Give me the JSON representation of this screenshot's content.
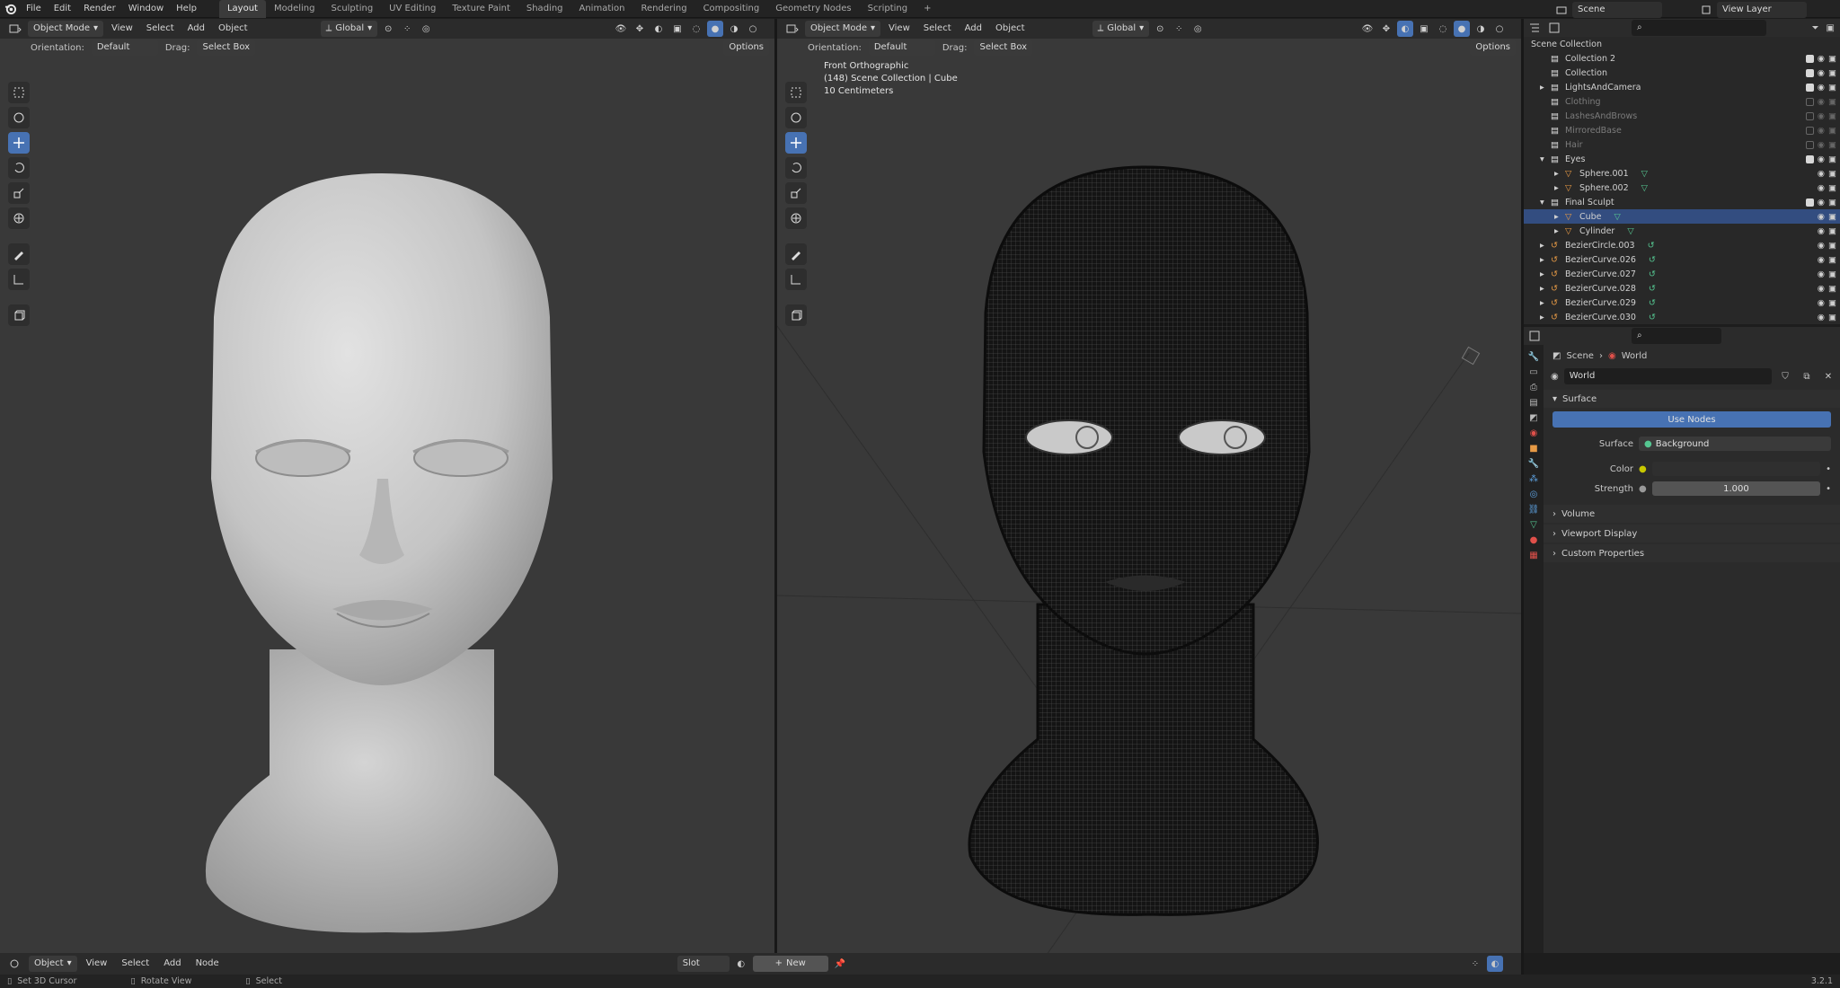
{
  "topbar": {
    "menu": [
      "File",
      "Edit",
      "Render",
      "Window",
      "Help"
    ],
    "workspaces": [
      "Layout",
      "Modeling",
      "Sculpting",
      "UV Editing",
      "Texture Paint",
      "Shading",
      "Animation",
      "Rendering",
      "Compositing",
      "Geometry Nodes",
      "Scripting"
    ],
    "active_workspace": "Layout",
    "add_tab": "+",
    "scene_label": "Scene",
    "view_layer_label": "View Layer"
  },
  "left_viewport": {
    "mode": "Object Mode",
    "menus": [
      "View",
      "Select",
      "Add",
      "Object"
    ],
    "transform": "Global",
    "orientation_label": "Orientation:",
    "orientation_value": "Default",
    "drag_label": "Drag:",
    "drag_value": "Select Box",
    "options": "Options"
  },
  "right_viewport": {
    "mode": "Object Mode",
    "menus": [
      "View",
      "Select",
      "Add",
      "Object"
    ],
    "transform": "Global",
    "orientation_label": "Orientation:",
    "orientation_value": "Default",
    "drag_label": "Drag:",
    "drag_value": "Select Box",
    "options": "Options",
    "overlay_lines": [
      "Front Orthographic",
      "(148) Scene Collection | Cube",
      "10 Centimeters"
    ]
  },
  "outliner": {
    "root": "Scene Collection",
    "rows": [
      {
        "name": "Collection 2",
        "indent": 0,
        "type": "collection",
        "checked": true
      },
      {
        "name": "Collection",
        "indent": 0,
        "type": "collection",
        "checked": true
      },
      {
        "name": "LightsAndCamera",
        "indent": 0,
        "type": "collection",
        "checked": true,
        "arrow": "▸"
      },
      {
        "name": "Clothing",
        "indent": 0,
        "type": "collection",
        "checked": false,
        "dim": true
      },
      {
        "name": "LashesAndBrows",
        "indent": 0,
        "type": "collection",
        "checked": false,
        "dim": true
      },
      {
        "name": "MirroredBase",
        "indent": 0,
        "type": "collection",
        "checked": false,
        "dim": true
      },
      {
        "name": "Hair",
        "indent": 0,
        "type": "collection",
        "checked": false,
        "dim": true
      },
      {
        "name": "Eyes",
        "indent": 0,
        "type": "collection",
        "checked": true,
        "arrow": "▾"
      },
      {
        "name": "Sphere.001",
        "indent": 1,
        "type": "mesh",
        "arrow": "▸"
      },
      {
        "name": "Sphere.002",
        "indent": 1,
        "type": "mesh",
        "arrow": "▸"
      },
      {
        "name": "Final Sculpt",
        "indent": 0,
        "type": "collection",
        "checked": true,
        "arrow": "▾"
      },
      {
        "name": "Cube",
        "indent": 1,
        "type": "mesh",
        "arrow": "▸",
        "selected": true
      },
      {
        "name": "Cylinder",
        "indent": 1,
        "type": "mesh",
        "arrow": "▸"
      },
      {
        "name": "BezierCircle.003",
        "indent": 0,
        "type": "curve",
        "arrow": "▸"
      },
      {
        "name": "BezierCurve.026",
        "indent": 0,
        "type": "curve",
        "arrow": "▸"
      },
      {
        "name": "BezierCurve.027",
        "indent": 0,
        "type": "curve",
        "arrow": "▸"
      },
      {
        "name": "BezierCurve.028",
        "indent": 0,
        "type": "curve",
        "arrow": "▸"
      },
      {
        "name": "BezierCurve.029",
        "indent": 0,
        "type": "curve",
        "arrow": "▸"
      },
      {
        "name": "BezierCurve.030",
        "indent": 0,
        "type": "curve",
        "arrow": "▸"
      }
    ]
  },
  "properties": {
    "breadcrumb": [
      "Scene",
      "World"
    ],
    "world_name": "World",
    "surface_panel": "Surface",
    "use_nodes": "Use Nodes",
    "surface_label": "Surface",
    "surface_value": "Background",
    "color_label": "Color",
    "strength_label": "Strength",
    "strength_value": "1.000",
    "panels": [
      "Volume",
      "Viewport Display",
      "Custom Properties"
    ]
  },
  "bottom_header": {
    "mode": "Object",
    "menus": [
      "View",
      "Select",
      "Add",
      "Node"
    ],
    "slot": "Slot",
    "new_button": "New"
  },
  "statusbar": {
    "items": [
      "Set 3D Cursor",
      "Rotate View",
      "Select"
    ],
    "version": "3.2.1"
  },
  "colors": {
    "accent": "#4772b3",
    "selected_row": "#334d80",
    "mesh_icon": "#e79a45",
    "data_icon": "#55c691",
    "viewport_bg": "#393939"
  }
}
